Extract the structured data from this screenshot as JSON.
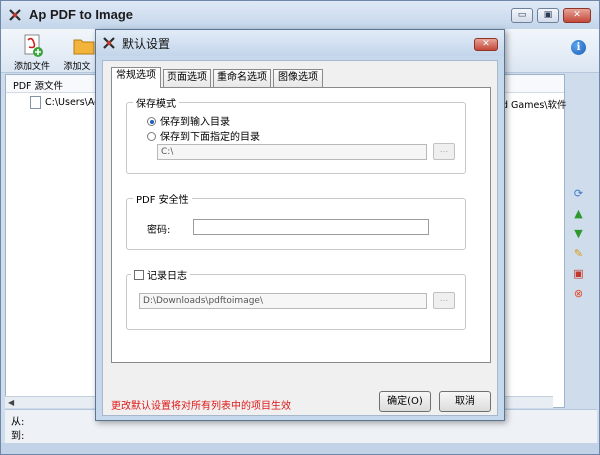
{
  "app": {
    "title": "Ap PDF to Image",
    "icon": "ap-logo-icon",
    "caption_buttons": {
      "minimize": "▭",
      "maximize": "▣",
      "close": "✕"
    }
  },
  "toolbar": {
    "add_file_label": "添加文件",
    "add_folder_label": "添加文",
    "info_icon": "i"
  },
  "list": {
    "header": "PDF 源文件",
    "rows": [
      {
        "path_start": "C:\\Users\\Adm",
        "path_end": "d Games\\软件"
      }
    ]
  },
  "side_tools": [
    "refresh-icon",
    "move-up-icon",
    "move-down-icon",
    "edit-icon",
    "clear-icon",
    "remove-icon"
  ],
  "status": {
    "from_label": "从:",
    "to_label": "到:"
  },
  "dialog": {
    "title": "默认设置",
    "close": "✕",
    "tabs": [
      {
        "label": "常规选项",
        "active": true
      },
      {
        "label": "页面选项",
        "active": false
      },
      {
        "label": "重命名选项",
        "active": false
      },
      {
        "label": "图像选项",
        "active": false
      }
    ],
    "save_mode": {
      "legend": "保存模式",
      "option_input_dir": "保存到输入目录",
      "option_custom_dir": "保存到下面指定的目录",
      "selected": "option_input_dir",
      "dir_value": "C:\\",
      "browse_label": "..."
    },
    "pdf_security": {
      "legend": "PDF 安全性",
      "password_label": "密码:",
      "password_value": ""
    },
    "logging": {
      "checkbox_label": "记录日志",
      "checked": false,
      "path_value": "D:\\Downloads\\pdftoimage\\",
      "browse_label": "..."
    },
    "note": "更改默认设置将对所有列表中的项目生效",
    "ok_label": "确定(O)",
    "cancel_label": "取消"
  }
}
